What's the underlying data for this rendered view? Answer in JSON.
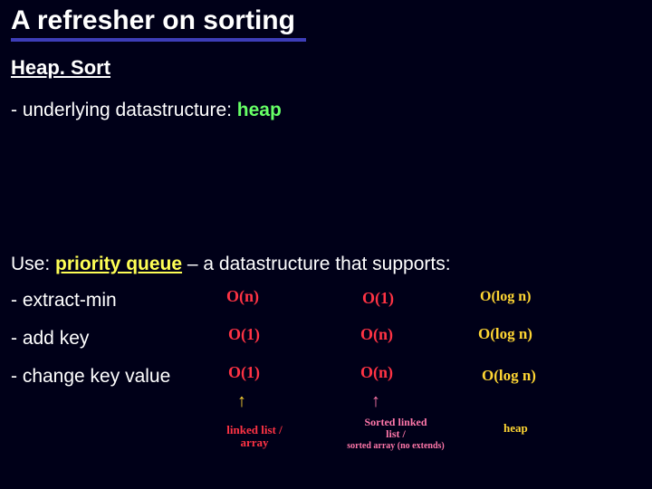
{
  "title": "A refresher on sorting",
  "subtitle": "Heap. Sort",
  "line_ds_prefix": "- underlying datastructure:  ",
  "line_ds_value": "heap",
  "line_use_prefix": "Use: ",
  "line_use_pq": "priority queue",
  "line_use_suffix": " – a datastructure that supports:",
  "ops": {
    "extract_min": "- extract-min",
    "add_key": "- add key",
    "change_key": "- change key value"
  },
  "cells": {
    "extract_c1": "O(n)",
    "extract_c2": "O(1)",
    "extract_c3": "O(log n)",
    "add_c1": "O(1)",
    "add_c2": "O(n)",
    "add_c3": "O(log n)",
    "change_c1": "O(1)",
    "change_c2": "O(n)",
    "change_c3": "O(log n)"
  },
  "arrows": {
    "a1": "↑",
    "a2": "↑"
  },
  "labels": {
    "col1_l1": "linked list /",
    "col1_l2": "array",
    "col2_l1": "Sorted linked",
    "col2_l2": "list /",
    "col2_l3": "sorted array (no extends)",
    "col3": "heap"
  }
}
